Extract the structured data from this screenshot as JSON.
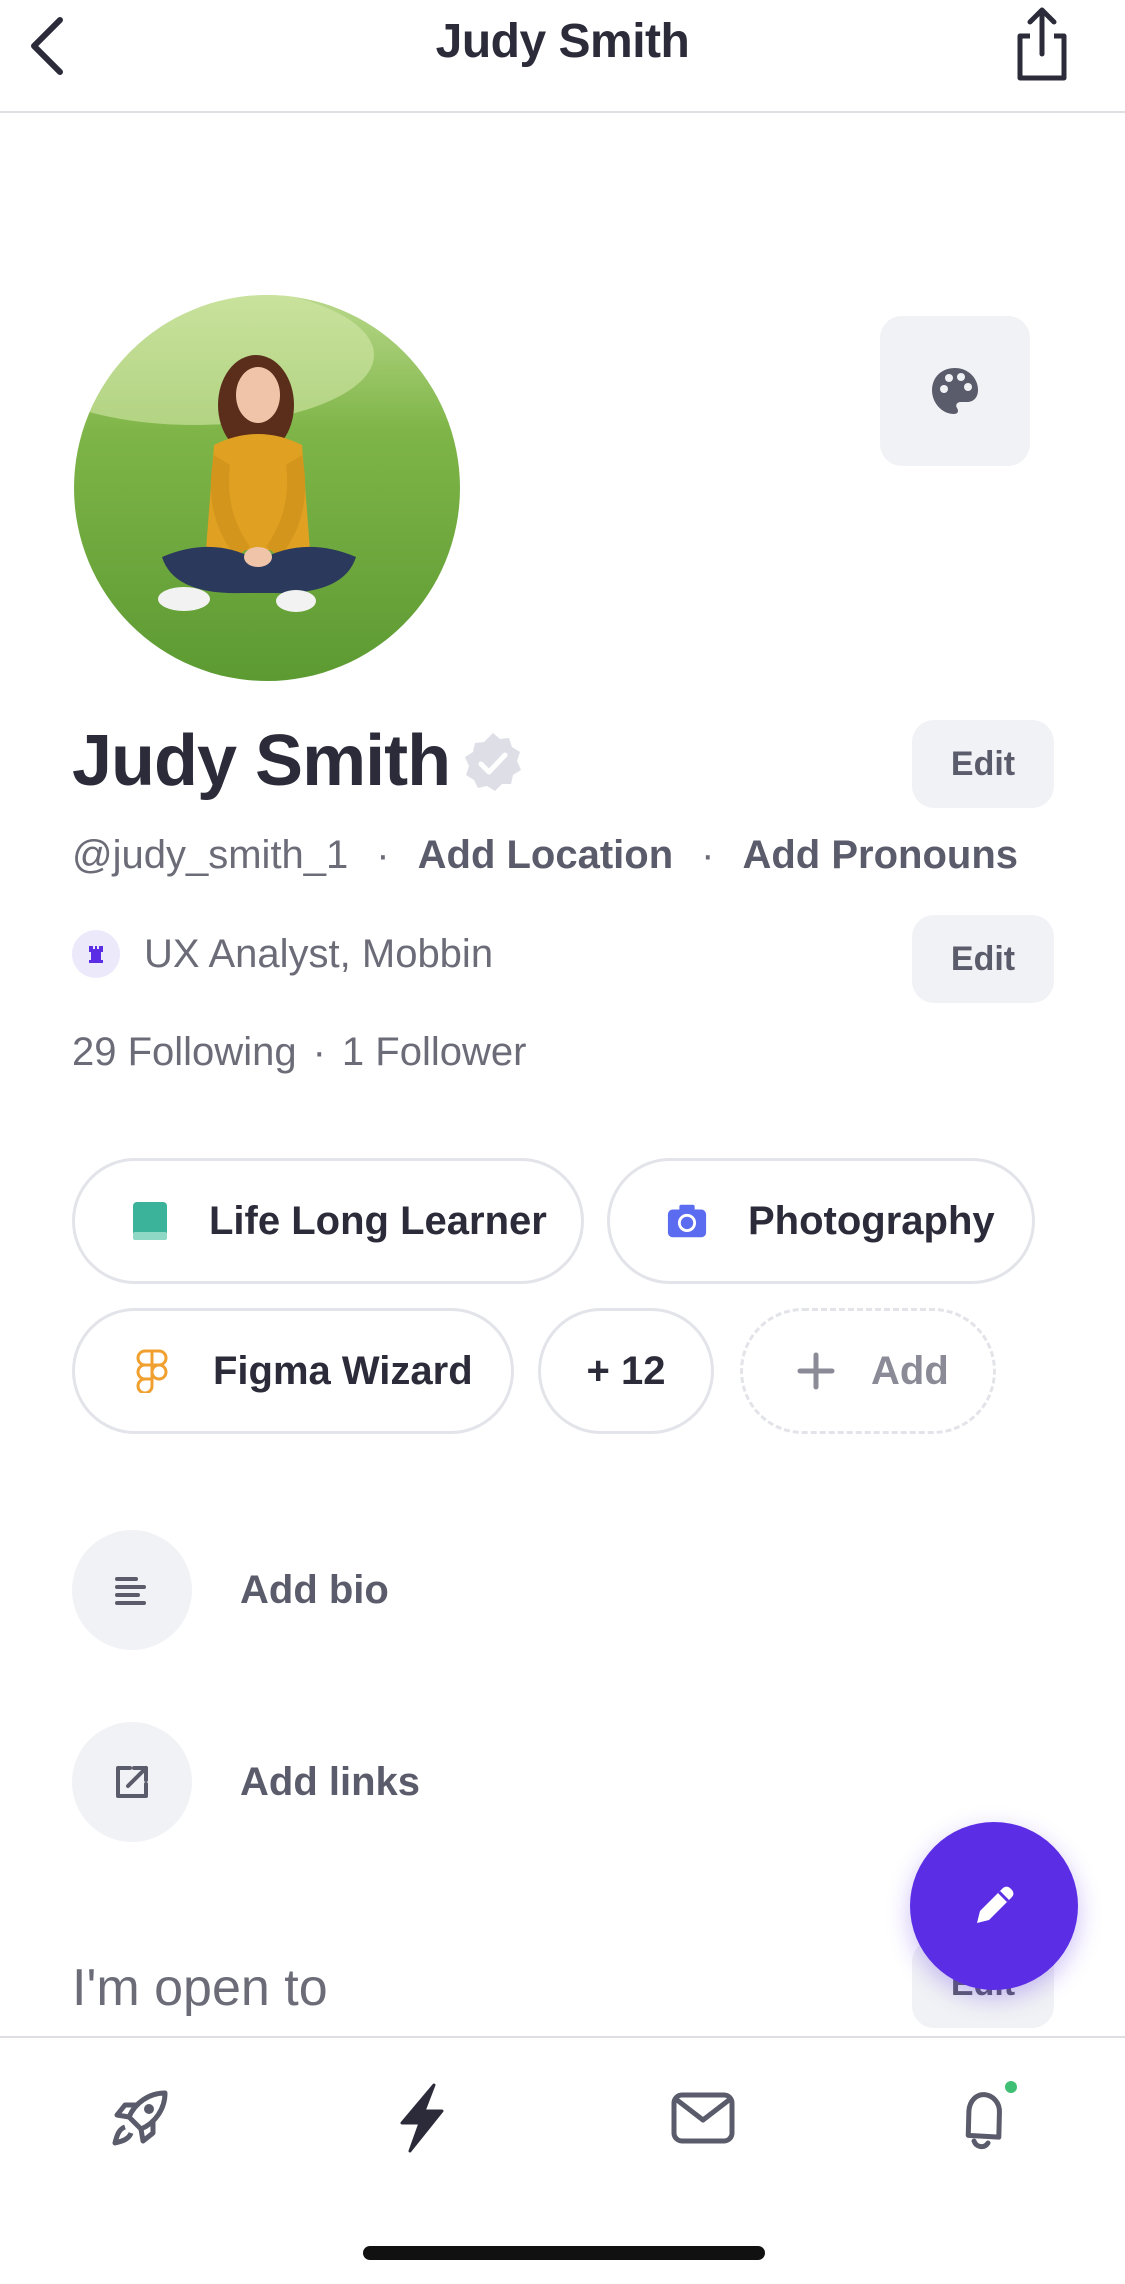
{
  "header": {
    "title": "Judy Smith",
    "back_icon": "chevron-left-icon",
    "share_icon": "share-icon"
  },
  "profile": {
    "name": "Judy Smith",
    "verified_icon": "verified-badge-icon",
    "handle": "@judy_smith_1",
    "add_location": "Add Location",
    "add_pronouns": "Add Pronouns",
    "separator": "·",
    "job": "UX Analyst, Mobbin",
    "following": "29 Following",
    "followers": "1 Follower",
    "edit_label": "Edit"
  },
  "chips": [
    {
      "label": "Life Long Learner",
      "icon": "book-icon",
      "color": "#3bb39a"
    },
    {
      "label": "Photography",
      "icon": "camera-icon",
      "color": "#5b6cf0"
    },
    {
      "label": "Figma Wizard",
      "icon": "figma-icon",
      "color": "#f0a030"
    },
    {
      "label": "+ 12"
    },
    {
      "label": "Add",
      "icon": "plus-icon"
    }
  ],
  "actions": {
    "bio": "Add bio",
    "links": "Add links"
  },
  "open_to": "I'm open to",
  "nav": [
    "rocket-icon",
    "lightning-icon",
    "mail-icon",
    "bell-icon"
  ],
  "colors": {
    "accent": "#5b2ee6",
    "chip_border": "#e3e4e9",
    "button_bg": "#f1f2f5",
    "notification_dot": "#3fbf73"
  }
}
